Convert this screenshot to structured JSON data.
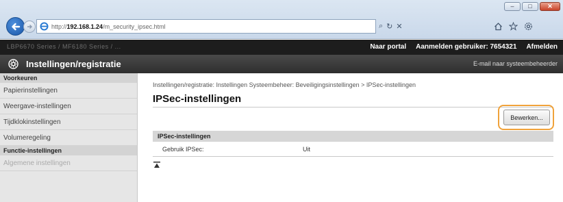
{
  "browser": {
    "url_prefix": "http://",
    "url_host": "192.168.1.24",
    "url_path": "/m_security_ipsec.html",
    "search_glyph": "⌕",
    "refresh_glyph": "↻",
    "stop_glyph": "✕"
  },
  "topbar": {
    "device_name": "LBP6670 Series / MF6180 Series / ...",
    "portal_link": "Naar portal",
    "login_label": "Aanmelden gebruiker:",
    "login_user": "7654321",
    "logout_link": "Afmelden"
  },
  "header": {
    "title": "Instellingen/registratie",
    "mail_link": "E-mail naar systeembeheerder"
  },
  "sidebar": {
    "section_preferences": "Voorkeuren",
    "items": [
      {
        "label": "Papierinstellingen"
      },
      {
        "label": "Weergave-instellingen"
      },
      {
        "label": "Tijdklokinstellingen"
      },
      {
        "label": "Volumeregeling"
      }
    ],
    "section_functions": "Functie-instellingen",
    "function_items": [
      {
        "label": "Algemene instellingen"
      }
    ]
  },
  "main": {
    "breadcrumb": "Instellingen/registratie: Instellingen Systeembeheer: Beveiligingsinstellingen > IPSec-instellingen",
    "page_title": "IPSec-instellingen",
    "edit_button": "Bewerken...",
    "section_title": "IPSec-instellingen",
    "rows": [
      {
        "label": "Gebruik IPSec:",
        "value": "Uit"
      }
    ]
  },
  "colors": {
    "highlight": "#f0a23a",
    "title_bar": "#2e2e2e",
    "top_strip": "#1d1d1d"
  }
}
